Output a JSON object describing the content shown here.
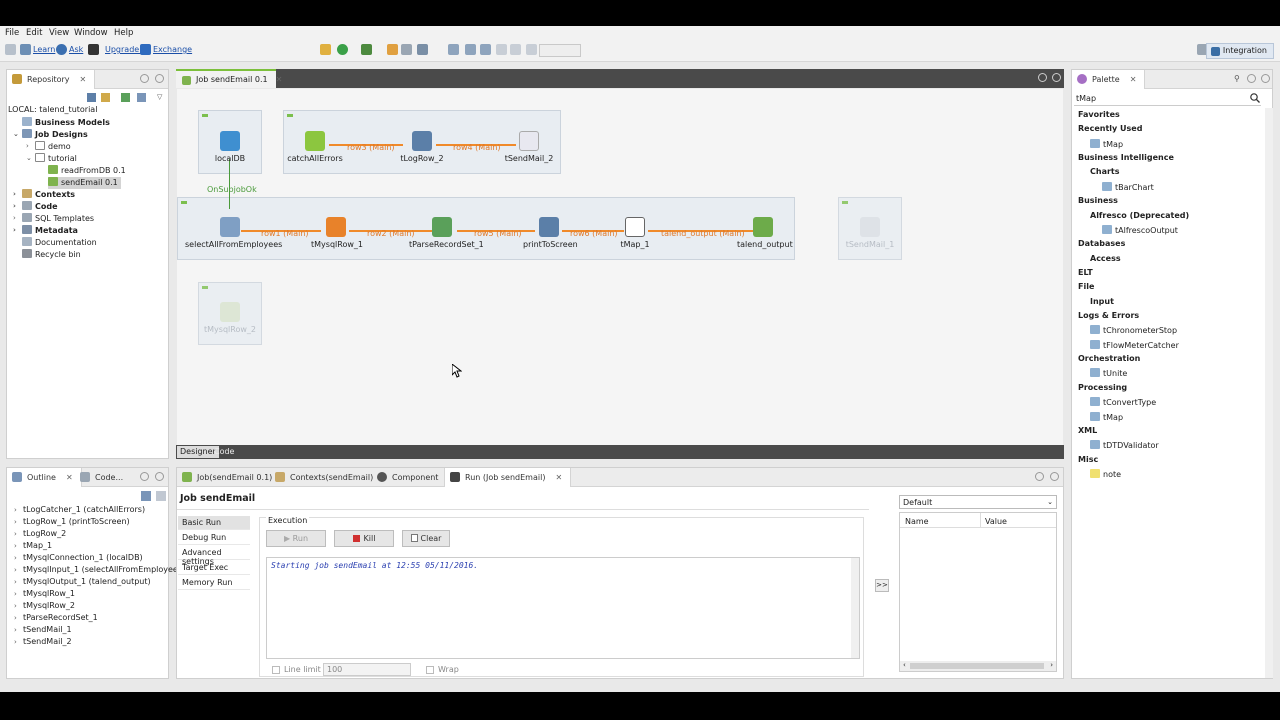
{
  "menu": [
    "File",
    "Edit",
    "View",
    "Window",
    "Help"
  ],
  "toolbar": {
    "links": [
      "Learn",
      "Ask",
      "Upgrade!",
      "Exchange"
    ],
    "perspective": "Integration"
  },
  "repository": {
    "tab": "Repository",
    "root": "LOCAL: talend_tutorial",
    "items": [
      {
        "label": "Business Models",
        "bold": true
      },
      {
        "label": "Job Designs",
        "bold": true
      },
      {
        "label": "demo"
      },
      {
        "label": "tutorial"
      },
      {
        "label": "readFromDB 0.1"
      },
      {
        "label": "sendEmail 0.1"
      },
      {
        "label": "Contexts",
        "bold": true
      },
      {
        "label": "Code",
        "bold": true
      },
      {
        "label": "SQL Templates",
        "bold": false
      },
      {
        "label": "Metadata",
        "bold": true
      },
      {
        "label": "Documentation"
      },
      {
        "label": "Recycle bin"
      }
    ]
  },
  "editor": {
    "tab": "Job sendEmail 0.1",
    "bottom_tabs": [
      "Designer",
      "Code"
    ]
  },
  "canvas": {
    "components": {
      "localdb": "localDB",
      "catch": "catchAllErrors",
      "logrow2": "tLogRow_2",
      "sendmail2": "tSendMail_2",
      "select": "selectAllFromEmployees",
      "mysqlrow1": "tMysqlRow_1",
      "parse": "tParseRecordSet_1",
      "print": "printToScreen",
      "tmap": "tMap_1",
      "output": "talend_output",
      "sendmail1": "tSendMail_1",
      "mysqlrow2": "tMysqlRow_2"
    },
    "links": {
      "row3": "row3 (Main)",
      "row4": "row4 (Main)",
      "row1": "row1 (Main)",
      "row2": "row2 (Main)",
      "row5": "row5 (Main)",
      "row6": "row6 (Main)",
      "talend_output": "talend_output (Main)",
      "onsubjob": "OnSubjobOk"
    }
  },
  "palette": {
    "tab": "Palette",
    "search": "tMap",
    "groups": [
      {
        "label": "Favorites",
        "level": 0
      },
      {
        "label": "Recently Used",
        "level": 0
      },
      {
        "label": "tMap",
        "level": 2,
        "item": true
      },
      {
        "label": "Business Intelligence",
        "level": 0
      },
      {
        "label": "Charts",
        "level": 1
      },
      {
        "label": "tBarChart",
        "level": 3,
        "item": true
      },
      {
        "label": "Business",
        "level": 0
      },
      {
        "label": "Alfresco (Deprecated)",
        "level": 1
      },
      {
        "label": "tAlfrescoOutput",
        "level": 3,
        "item": true
      },
      {
        "label": "Databases",
        "level": 0
      },
      {
        "label": "Access",
        "level": 1
      },
      {
        "label": "ELT",
        "level": 0
      },
      {
        "label": "File",
        "level": 0
      },
      {
        "label": "Input",
        "level": 1
      },
      {
        "label": "Logs & Errors",
        "level": 0
      },
      {
        "label": "tChronometerStop",
        "level": 2,
        "item": true
      },
      {
        "label": "tFlowMeterCatcher",
        "level": 2,
        "item": true
      },
      {
        "label": "Orchestration",
        "level": 0
      },
      {
        "label": "tUnite",
        "level": 2,
        "item": true
      },
      {
        "label": "Processing",
        "level": 0
      },
      {
        "label": "tConvertType",
        "level": 2,
        "item": true
      },
      {
        "label": "tMap",
        "level": 2,
        "item": true
      },
      {
        "label": "XML",
        "level": 0
      },
      {
        "label": "tDTDValidator",
        "level": 2,
        "item": true
      },
      {
        "label": "Misc",
        "level": 0
      },
      {
        "label": "note",
        "level": 2,
        "item": true
      }
    ]
  },
  "outline": {
    "tabs": [
      "Outline",
      "Code..."
    ],
    "items": [
      "tLogCatcher_1 (catchAllErrors)",
      "tLogRow_1 (printToScreen)",
      "tLogRow_2",
      "tMap_1",
      "tMysqlConnection_1 (localDB)",
      "tMysqlInput_1 (selectAllFromEmployees)",
      "tMysqlOutput_1 (talend_output)",
      "tMysqlRow_1",
      "tMysqlRow_2",
      "tParseRecordSet_1",
      "tSendMail_1",
      "tSendMail_2"
    ]
  },
  "run": {
    "tabs": [
      "Job(sendEmail 0.1)",
      "Contexts(sendEmail)",
      "Component",
      "Run (Job sendEmail)"
    ],
    "title": "Job sendEmail",
    "side": [
      "Basic Run",
      "Debug Run",
      "Advanced settings",
      "Target Exec",
      "Memory Run"
    ],
    "execution_label": "Execution",
    "buttons": {
      "run": "Run",
      "kill": "Kill",
      "clear": "Clear"
    },
    "console": "Starting job sendEmail at 12:55 05/11/2016.",
    "line_limit_label": "Line limit",
    "line_limit_value": "100",
    "wrap_label": "Wrap",
    "arrow": ">>",
    "context": "Default",
    "table_headers": [
      "Name",
      "Value"
    ]
  },
  "colors": {
    "link": "#f08a2a",
    "subjob": "#e8edf2",
    "accent": "#1b4fa8"
  }
}
